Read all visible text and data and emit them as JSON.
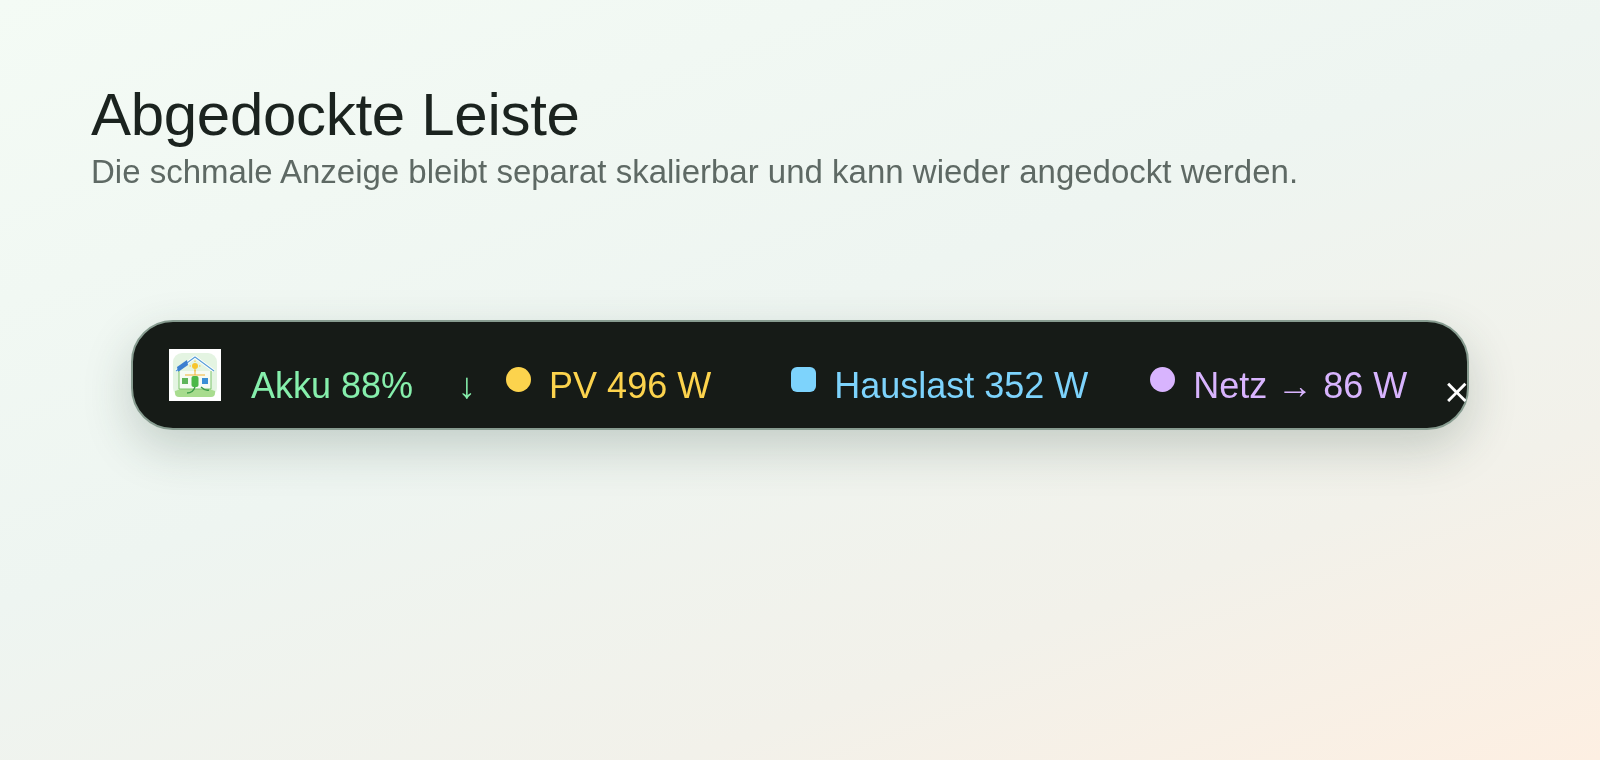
{
  "page": {
    "title": "Abgedockte Leiste",
    "subtitle": "Die schmale Anzeige bleibt separat skalierbar und kann wieder angedockt werden."
  },
  "bar": {
    "metrics": [
      {
        "kind": "battery",
        "label": "Akku 88%",
        "trend": "↓",
        "color": "#86efac"
      },
      {
        "kind": "pv",
        "label": "PV 496 W",
        "color": "#fcd34d"
      },
      {
        "kind": "load",
        "label": "Hauslast 352 W",
        "color": "#7dd3fc"
      },
      {
        "kind": "grid",
        "label": "Netz → 86 W",
        "color": "#d8b4fe"
      }
    ],
    "close": "×"
  }
}
